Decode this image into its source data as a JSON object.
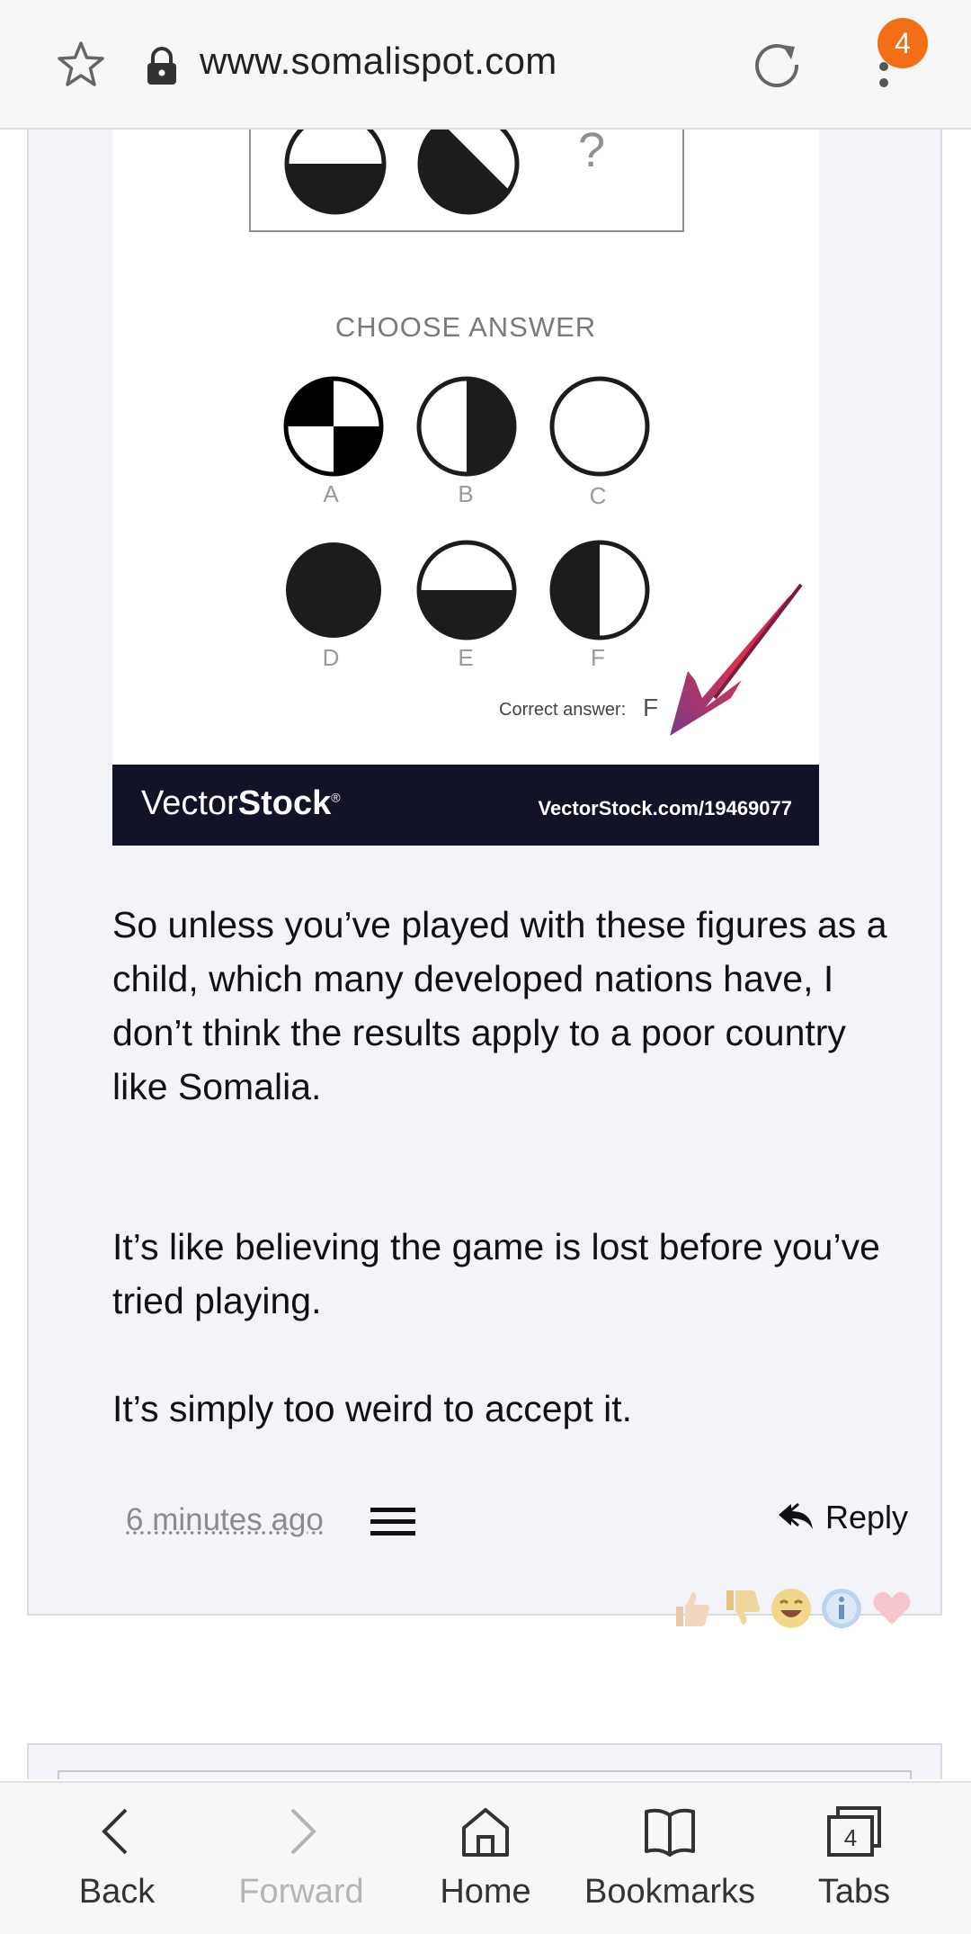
{
  "browser": {
    "url": "www.somalispot.com",
    "tab_count_badge": "4"
  },
  "image": {
    "question_mark": "?",
    "choose_answer": "CHOOSE ANSWER",
    "options": [
      "A",
      "B",
      "C",
      "D",
      "E",
      "F"
    ],
    "correct_label": "Correct answer:",
    "correct_letter": "F",
    "watermark_logo_regular": "Vector",
    "watermark_logo_bold": "Stock",
    "watermark_logo_mark": "®",
    "watermark_url": "VectorStock.com/19469077"
  },
  "post": {
    "paragraphs": [
      "So unless you’ve played with these figures as a child, which many developed nations have, I don’t think the results apply to a poor country like Somalia.",
      "It’s like believing the game is lost before you’ve tried playing.",
      "It’s simply too weird to accept it."
    ],
    "timestamp": "6 minutes ago",
    "reply_label": "Reply",
    "reactions": [
      "thumbs-up",
      "thumbs-down",
      "laugh",
      "info",
      "heart"
    ]
  },
  "bottom_nav": {
    "back": "Back",
    "forward": "Forward",
    "home": "Home",
    "bookmarks": "Bookmarks",
    "tabs": "Tabs",
    "tabs_count": "4"
  }
}
